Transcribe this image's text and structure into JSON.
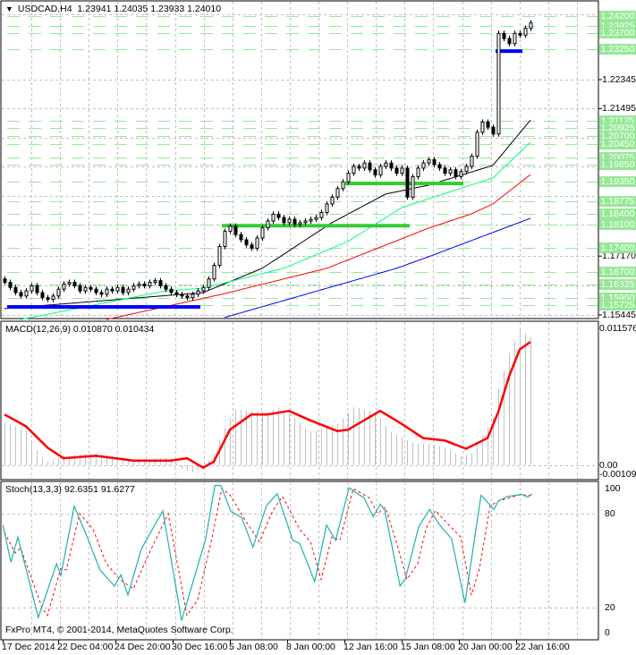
{
  "header": {
    "symbol": "USDCAD,H4",
    "open": "1.23941",
    "high": "1.24035",
    "low": "1.23933",
    "close": "1.24010"
  },
  "copyright": "FxPro MT4, © 2001-2014, MetaQuotes Software Corp.",
  "colors": {
    "level_green": "#32cd32",
    "level_blue": "#0000ff",
    "label_green": "#96e896",
    "macd_signal": "#ff0000",
    "macd_hist": "#c0c0c0",
    "stoch_main": "#20b2aa",
    "stoch_signal": "#ff0000"
  },
  "chart_data": {
    "type": "candlestick",
    "title": "USDCAD,H4",
    "ylim": [
      1.15445,
      1.2443
    ],
    "y_tick_labels": [
      "1.22345",
      "1.21495",
      "1.17170",
      "1.15445"
    ],
    "x_tick_labels": [
      "17 Dec 2014",
      "22 Dec 04:00",
      "24 Dec 20:00",
      "30 Dec 16:00",
      "5 Jan 08:00",
      "8 Jan 00:00",
      "12 Jan 16:00",
      "15 Jan 08:00",
      "20 Jan 00:00",
      "22 Jan 16:00"
    ],
    "price_labels": [
      "1.24200",
      "1.23925",
      "1.23700",
      "1.23250",
      "1.21125",
      "1.20925",
      "1.20700",
      "1.20450",
      "1.20075",
      "1.19850",
      "1.19350",
      "1.18775",
      "1.18400",
      "1.18100",
      "1.17400",
      "1.16700",
      "1.16325",
      "1.15950",
      "1.15725"
    ],
    "first_open": 1.165,
    "closes": [
      1.164,
      1.1625,
      1.161,
      1.16,
      1.1615,
      1.163,
      1.161,
      1.1595,
      1.159,
      1.16,
      1.162,
      1.1635,
      1.164,
      1.163,
      1.1615,
      1.1625,
      1.162,
      1.161,
      1.1605,
      1.162,
      1.1615,
      1.1625,
      1.161,
      1.162,
      1.163,
      1.1635,
      1.163,
      1.164,
      1.1645,
      1.163,
      1.162,
      1.161,
      1.1605,
      1.16,
      1.1595,
      1.1605,
      1.1615,
      1.1625,
      1.165,
      1.169,
      1.1745,
      1.179,
      1.1805,
      1.178,
      1.1765,
      1.175,
      1.174,
      1.177,
      1.18,
      1.182,
      1.184,
      1.183,
      1.1815,
      1.1825,
      1.181,
      1.1815,
      1.182,
      1.1825,
      1.183,
      1.1845,
      1.187,
      1.189,
      1.1915,
      1.1935,
      1.196,
      1.198,
      1.1975,
      1.199,
      1.197,
      1.1955,
      1.198,
      1.199,
      1.1975,
      1.196,
      1.1975,
      1.189,
      1.195,
      1.1975,
      1.199,
      1.2,
      1.1985,
      1.1975,
      1.196,
      1.197,
      1.195,
      1.1965,
      1.198,
      1.201,
      1.208,
      1.211,
      1.2095,
      1.2075,
      1.237,
      1.2355,
      1.234,
      1.237,
      1.2365,
      1.2385,
      1.2401
    ],
    "moving_averages": [
      {
        "color": "#000000",
        "points": [
          [
            0,
            1.1563
          ],
          [
            37,
            1.161
          ],
          [
            48,
            1.1681
          ],
          [
            61,
            1.1815
          ],
          [
            71,
            1.1899
          ],
          [
            79,
            1.1925
          ],
          [
            91,
            1.1983
          ],
          [
            98,
            1.2116
          ]
        ]
      },
      {
        "color": "#00ff7f",
        "points": [
          [
            3,
            1.1531
          ],
          [
            30,
            1.1615
          ],
          [
            37,
            1.1623
          ],
          [
            52,
            1.1681
          ],
          [
            64,
            1.176
          ],
          [
            74,
            1.1859
          ],
          [
            79,
            1.1885
          ],
          [
            91,
            1.1946
          ],
          [
            98,
            1.2051
          ]
        ]
      },
      {
        "color": "#ff0000",
        "points": [
          [
            19,
            1.1531
          ],
          [
            41,
            1.1607
          ],
          [
            60,
            1.1681
          ],
          [
            79,
            1.1799
          ],
          [
            87,
            1.1841
          ],
          [
            91,
            1.187
          ],
          [
            98,
            1.1956
          ]
        ]
      },
      {
        "color": "#0000ff",
        "points": [
          [
            41,
            1.1537
          ],
          [
            73,
            1.1681
          ],
          [
            79,
            1.1715
          ],
          [
            98,
            1.1828
          ]
        ]
      }
    ],
    "levels": [
      {
        "price": 1.1568,
        "from": 1,
        "to": 36,
        "color": "#0000ff"
      },
      {
        "price": 1.1806,
        "from": 41,
        "to": 75,
        "color": "#32cd32"
      },
      {
        "price": 1.193,
        "from": 64,
        "to": 85,
        "color": "#32cd32"
      },
      {
        "price": 1.2318,
        "from": 92,
        "to": 96,
        "color": "#0000ff"
      }
    ],
    "macd": {
      "label": "MACD(12,26,9) 0.010870 0.010434",
      "ylim": [
        -0.00109,
        0.011576
      ],
      "tick_labels": [
        "0.011576",
        "0.00",
        "-0.00109"
      ],
      "histogram": [
        [
          0,
          0.0036
        ],
        [
          4,
          0.003
        ],
        [
          5,
          0.0019
        ],
        [
          7,
          0.0006
        ],
        [
          8,
          0.0003
        ],
        [
          11,
          0.0008
        ],
        [
          17,
          0.001
        ],
        [
          24,
          0.0005
        ],
        [
          31,
          0.0006
        ],
        [
          33,
          -0.0003
        ],
        [
          35,
          -0.0006
        ],
        [
          37,
          -0.0002
        ],
        [
          39,
          0.001
        ],
        [
          41,
          0.0032
        ],
        [
          43,
          0.0047
        ],
        [
          49,
          0.0045
        ],
        [
          51,
          0.0049
        ],
        [
          54,
          0.004
        ],
        [
          57,
          0.0028
        ],
        [
          62,
          0.0035
        ],
        [
          65,
          0.0049
        ],
        [
          69,
          0.0045
        ],
        [
          72,
          0.0028
        ],
        [
          76,
          0.0019
        ],
        [
          79,
          0.0018
        ],
        [
          82,
          0.0015
        ],
        [
          85,
          0.0008
        ],
        [
          87,
          0.001
        ],
        [
          89,
          0.0025
        ],
        [
          91,
          0.004
        ],
        [
          92,
          0.0065
        ],
        [
          94,
          0.0095
        ],
        [
          96,
          0.0115
        ],
        [
          98,
          0.01087
        ]
      ],
      "signal": [
        [
          0,
          0.0043
        ],
        [
          4,
          0.0033
        ],
        [
          8,
          0.0015
        ],
        [
          11,
          0.0006
        ],
        [
          17,
          0.0008
        ],
        [
          24,
          0.0004
        ],
        [
          31,
          0.0004
        ],
        [
          34,
          0.0006
        ],
        [
          37,
          -0.0002
        ],
        [
          39,
          0.0003
        ],
        [
          42,
          0.003
        ],
        [
          46,
          0.0043
        ],
        [
          49,
          0.0043
        ],
        [
          53,
          0.0046
        ],
        [
          57,
          0.0038
        ],
        [
          62,
          0.0029
        ],
        [
          64,
          0.003
        ],
        [
          70,
          0.0046
        ],
        [
          74,
          0.0035
        ],
        [
          78,
          0.0023
        ],
        [
          82,
          0.0021
        ],
        [
          86,
          0.0014
        ],
        [
          90,
          0.0023
        ],
        [
          92,
          0.0045
        ],
        [
          94,
          0.0075
        ],
        [
          96,
          0.0098
        ],
        [
          98,
          0.010434
        ]
      ]
    },
    "stoch": {
      "label": "Stoch(13,3,3) 92.6351 91.6277",
      "ylim": [
        0,
        100
      ],
      "tick_labels": [
        "100",
        "80",
        "20",
        "0"
      ],
      "main": [
        [
          -0.3,
          72.7
        ],
        [
          1.2,
          49
        ],
        [
          2.5,
          65
        ],
        [
          6.3,
          13.7
        ],
        [
          9.7,
          48
        ],
        [
          10.5,
          40.6
        ],
        [
          13,
          84.7
        ],
        [
          15.3,
          66
        ],
        [
          17.8,
          44
        ],
        [
          20.5,
          33.7
        ],
        [
          21.7,
          41
        ],
        [
          23,
          28
        ],
        [
          25.5,
          57.5
        ],
        [
          29.5,
          81.7
        ],
        [
          33,
          11.8
        ],
        [
          37.5,
          64
        ],
        [
          39.2,
          98
        ],
        [
          40.3,
          98
        ],
        [
          42.2,
          81.3
        ],
        [
          44.2,
          77.5
        ],
        [
          46.3,
          58.5
        ],
        [
          48.8,
          85
        ],
        [
          50.8,
          92.7
        ],
        [
          52.5,
          75.6
        ],
        [
          53.7,
          63
        ],
        [
          55,
          61
        ],
        [
          57.8,
          36.6
        ],
        [
          60,
          72.7
        ],
        [
          61.7,
          63
        ],
        [
          64.2,
          96.6
        ],
        [
          67,
          90
        ],
        [
          68.7,
          78
        ],
        [
          70,
          86
        ],
        [
          70.8,
          83
        ],
        [
          73.7,
          33.7
        ],
        [
          74.7,
          38.5
        ],
        [
          77.2,
          71.8
        ],
        [
          79.2,
          82.7
        ],
        [
          81.3,
          71.8
        ],
        [
          83.3,
          64
        ],
        [
          85.8,
          23
        ],
        [
          88.8,
          91.8
        ],
        [
          91.2,
          82.7
        ],
        [
          92,
          88
        ],
        [
          93.7,
          90.9
        ],
        [
          96.3,
          92.3
        ],
        [
          97.5,
          90.5
        ],
        [
          98.3,
          92.6
        ]
      ],
      "signal": [
        [
          0,
          68
        ],
        [
          2,
          55
        ],
        [
          3,
          58
        ],
        [
          7,
          20
        ],
        [
          8,
          15
        ],
        [
          10.5,
          45
        ],
        [
          11.5,
          44
        ],
        [
          14,
          80
        ],
        [
          16.5,
          70
        ],
        [
          19,
          48
        ],
        [
          21.5,
          38
        ],
        [
          24,
          32
        ],
        [
          27,
          55
        ],
        [
          30.5,
          80
        ],
        [
          34,
          15
        ],
        [
          36,
          25
        ],
        [
          38.5,
          62
        ],
        [
          40.5,
          96
        ],
        [
          42,
          92
        ],
        [
          45,
          75
        ],
        [
          47.5,
          62
        ],
        [
          50,
          82
        ],
        [
          51.8,
          91
        ],
        [
          55,
          70
        ],
        [
          57,
          62
        ],
        [
          59,
          38
        ],
        [
          61,
          65
        ],
        [
          62.5,
          63
        ],
        [
          65,
          96
        ],
        [
          68,
          90
        ],
        [
          69.5,
          80
        ],
        [
          71,
          84
        ],
        [
          73,
          62
        ],
        [
          75,
          38
        ],
        [
          77,
          48
        ],
        [
          78.5,
          70
        ],
        [
          80.3,
          82
        ],
        [
          83,
          72
        ],
        [
          85,
          65
        ],
        [
          87,
          28
        ],
        [
          88.5,
          45
        ],
        [
          90.5,
          85
        ],
        [
          92,
          88
        ],
        [
          94,
          90
        ],
        [
          96,
          92
        ],
        [
          98.3,
          91.6
        ]
      ]
    }
  }
}
